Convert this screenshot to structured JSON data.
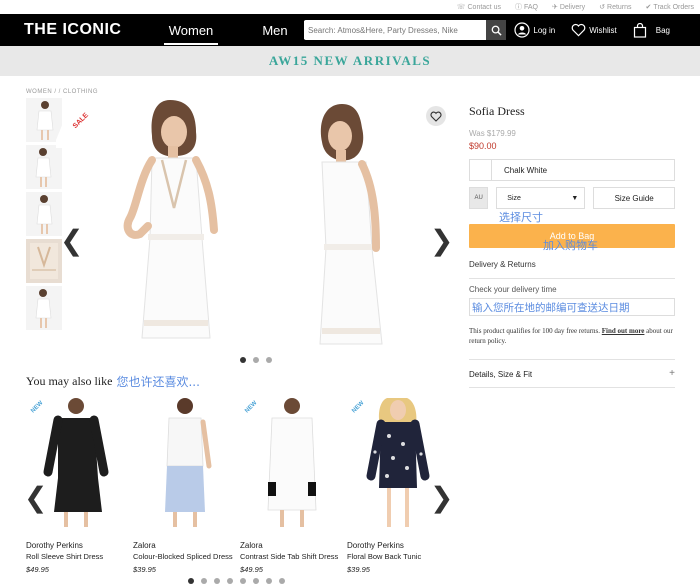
{
  "util": {
    "contact": "Contact us",
    "faq": "FAQ",
    "delivery": "Delivery",
    "returns": "Returns",
    "track": "Track Orders"
  },
  "header": {
    "logo": "THE ICONIC",
    "tabs": [
      {
        "label": "Women",
        "active": true
      },
      {
        "label": "Men",
        "active": false
      }
    ],
    "search_placeholder": "Search: Atmos&Here, Party Dresses, Nike",
    "login": "Log in",
    "wishlist": "Wishlist",
    "bag": "Bag"
  },
  "banner": {
    "text": "AW15 NEW ARRIVALS",
    "color": "#3aa69a"
  },
  "breadcrumb": "WOMEN / / CLOTHING",
  "sale_tag": "SALE",
  "gallery": {
    "dots": 3,
    "active": 0
  },
  "product": {
    "title": "Sofia Dress",
    "was": "Was $179.99",
    "price": "$90.00",
    "color": "Chalk White",
    "size_region": "AU",
    "size_placeholder": "Size",
    "size_guide": "Size Guide",
    "cn_size": "选择尺寸",
    "add_to_bag": "Add to Bag",
    "cn_add": "加入购物车",
    "delivery_returns": "Delivery & Returns",
    "check_delivery": "Check your delivery time",
    "cn_postcode": "输入您所在地的邮编可查送达日期",
    "policy_text": "This product qualifies for 100 day free returns.",
    "policy_link": "Find out more",
    "policy_text2": "about our return policy.",
    "details": "Details, Size & Fit",
    "details_icon": "+"
  },
  "also_like": {
    "title": "You may also like",
    "cn_title": "您也许还喜欢...",
    "new_tag": "NEW",
    "items": [
      {
        "brand": "Dorothy Perkins",
        "name": "Roll Sleeve Shirt Dress",
        "price": "$49.95"
      },
      {
        "brand": "Zalora",
        "name": "Colour-Blocked Spliced Dress",
        "price": "$39.95"
      },
      {
        "brand": "Zalora",
        "name": "Contrast Side Tab Shift Dress",
        "price": "$49.95"
      },
      {
        "brand": "Dorothy Perkins",
        "name": "Floral Bow Back Tunic",
        "price": "$39.95"
      }
    ],
    "dots": 8,
    "active": 0
  },
  "colors": {
    "accent": "#fbb24c",
    "price": "#c0392b",
    "cn_annotation": "#5b8ce0"
  }
}
